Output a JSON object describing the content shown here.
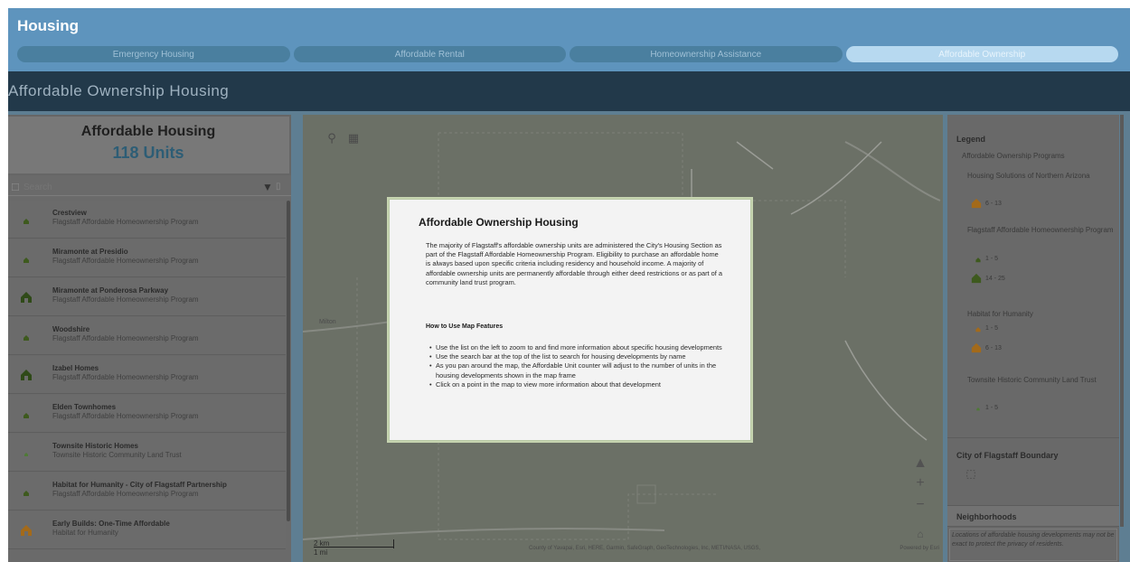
{
  "app": {
    "title": "Housing",
    "tabs": [
      {
        "label": "Emergency Housing",
        "active": false
      },
      {
        "label": "Affordable Rental",
        "active": false
      },
      {
        "label": "Homeownership Assistance",
        "active": false
      },
      {
        "label": "Affordable Ownership",
        "active": true
      }
    ],
    "page_title": "Affordable Ownership Housing"
  },
  "summary": {
    "title": "Affordable Housing",
    "value": "118 Units"
  },
  "search": {
    "placeholder": "Search"
  },
  "list": {
    "items": [
      {
        "name": "Crestview",
        "program": "Flagstaff Affordable Homeownership Program",
        "icon": "house-small-icon"
      },
      {
        "name": "Miramonte at Presidio",
        "program": "Flagstaff Affordable Homeownership Program",
        "icon": "house-small-icon"
      },
      {
        "name": "Miramonte at Ponderosa Parkway",
        "program": "Flagstaff Affordable Homeownership Program",
        "icon": "house-large-icon"
      },
      {
        "name": "Woodshire",
        "program": "Flagstaff Affordable Homeownership Program",
        "icon": "house-small-icon"
      },
      {
        "name": "Izabel Homes",
        "program": "Flagstaff Affordable Homeownership Program",
        "icon": "house-large-icon"
      },
      {
        "name": "Elden Townhomes",
        "program": "Flagstaff Affordable Homeownership Program",
        "icon": "house-small-icon"
      },
      {
        "name": "Townsite Historic Homes",
        "program": "Townsite Historic Community Land Trust",
        "icon": "house-tiny-icon"
      },
      {
        "name": "Habitat for Humanity - City of Flagstaff Partnership",
        "program": "Flagstaff Affordable Homeownership Program",
        "icon": "house-small-icon"
      },
      {
        "name": "Early Builds: One-Time Affordable",
        "program": "Habitat for Humanity",
        "icon": "house-orange-icon"
      }
    ]
  },
  "map": {
    "scale_km": "2 km",
    "scale_mi": "1 mi",
    "attribution": "County of Yavapai, Esri, HERE, Garmin, SafeGraph, GeoTechnologies, Inc, METI/NASA, USGS,",
    "powered_by": "Powered by Esri"
  },
  "legend": {
    "title": "Legend",
    "group_title": "Affordable Ownership Programs",
    "programs": [
      {
        "name": "Housing Solutions of Northern Arizona",
        "ranges": [
          "6 - 13"
        ]
      },
      {
        "name": "Flagstaff Affordable Homeownership Program",
        "ranges": [
          "1 - 5",
          "14 - 25"
        ]
      },
      {
        "name": "Habitat for Humanity",
        "ranges": [
          "1 - 5",
          "6 - 13"
        ]
      },
      {
        "name": "Townsite Historic Community Land Trust",
        "ranges": [
          "1 - 5"
        ]
      }
    ],
    "boundary_title": "City of Flagstaff Boundary",
    "neighborhoods_label": "Neighborhoods",
    "footnote": "Locations of affordable housing developments may not be exact to protect the privacy of residents.",
    "colors": {
      "green": "#3e5a1e",
      "orange": "#a36a1a",
      "lightgreen": "#4f7a36"
    }
  },
  "modal": {
    "title": "Affordable Ownership Housing",
    "paragraph": "The majority of Flagstaff's affordable ownership units are administered the City's Housing Section as part of the Flagstaff Affordable Homeownership Program. Eligibility to purchase an affordable home is always based upon specific criteria including residency and household income. A majority of affordable ownership units are permanently affordable through either deed restrictions or as part of a community land trust program.",
    "subheading": "How to Use Map Features",
    "bullets": [
      "Use the list on the left to zoom to and find more information about specific housing developments",
      "Use the search bar at the top of the list to search for housing developments by name",
      "As you pan around the map, the Affordable Unit counter will adjust to the number of units in the housing developments shown in the map frame",
      "Click on a point in the map to view more information about that development"
    ]
  }
}
